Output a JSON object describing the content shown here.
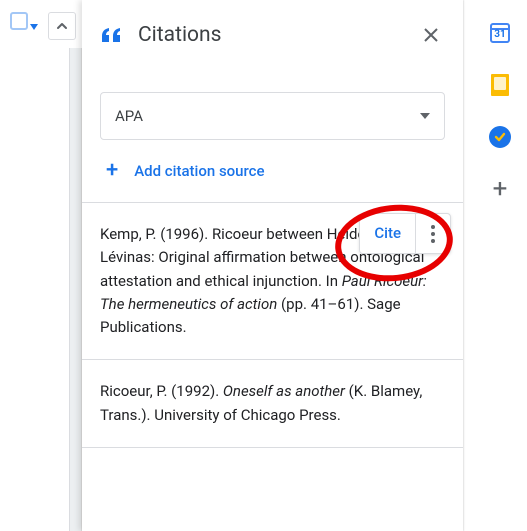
{
  "left_toolbar": {
    "collapse_label": "collapse"
  },
  "panel": {
    "title": "Citations",
    "format_selected": "APA",
    "add_label": "Add citation source",
    "cite_button": "Cite",
    "calendar_day": "31"
  },
  "citations": [
    {
      "pre": "Kemp, P. (1996). Ricoeur between Heidegger and Lévinas: Original affirmation between ontological attestation and ethical injunction. In ",
      "italic": "Paul Ricoeur: The hermeneutics of action",
      "post": " (pp. 41–61). Sage Publications."
    },
    {
      "pre": "Ricoeur, P. (1992). ",
      "italic": "Oneself as another",
      "post": " (K. Blamey, Trans.). University of Chicago Press."
    }
  ]
}
